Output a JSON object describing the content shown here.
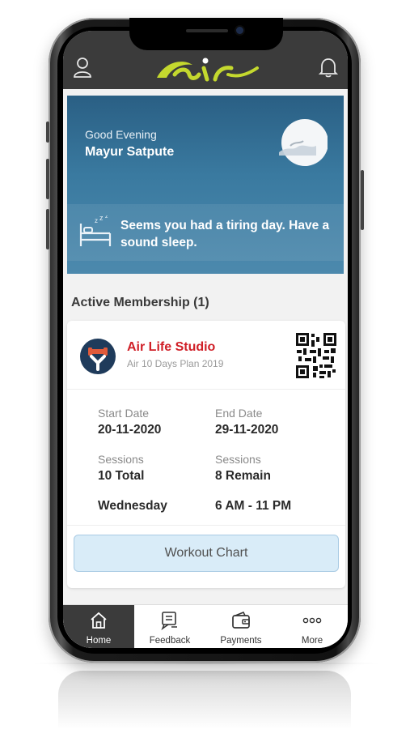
{
  "header": {
    "logo_text": "air"
  },
  "banner": {
    "greeting": "Good Evening",
    "user_name": "Mayur Satpute",
    "sleep_message": "Seems you had a tiring day. Have a sound sleep."
  },
  "membership": {
    "section_title": "Active Membership (1)",
    "studio_name": "Air Life Studio",
    "plan_name": "Air 10 Days Plan 2019",
    "start_label": "Start Date",
    "start_value": "20-11-2020",
    "end_label": "End Date",
    "end_value": "29-11-2020",
    "sessions_label": "Sessions",
    "sessions_total": "10 Total",
    "sessions_label_2": "Sessions",
    "sessions_remain": "8 Remain",
    "day": "Wednesday",
    "time": "6 AM - 11 PM",
    "workout_button": "Workout Chart"
  },
  "tabs": [
    {
      "label": "Home",
      "icon": "home-icon",
      "active": true
    },
    {
      "label": "Feedback",
      "icon": "feedback-icon",
      "active": false
    },
    {
      "label": "Payments",
      "icon": "wallet-icon",
      "active": false
    },
    {
      "label": "More",
      "icon": "more-icon",
      "active": false
    }
  ],
  "colors": {
    "header_bg": "#3b3b3b",
    "logo_green": "#c4d82e",
    "banner_blue": "#3a7aa0",
    "studio_red": "#d01f27",
    "button_bg": "#d9ecf8"
  }
}
